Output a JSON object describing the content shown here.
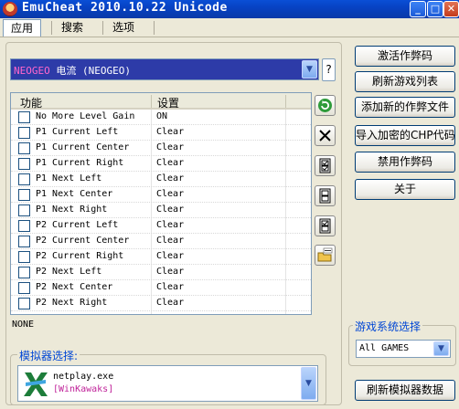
{
  "window": {
    "title": "EmuCheat 2010.10.22 Unicode"
  },
  "menu": {
    "apply": "应用",
    "search": "搜索",
    "options": "选项"
  },
  "game_select": {
    "tag": "NEOGEO",
    "name": " 电流 (NEOGEO)"
  },
  "help_label": "?",
  "table": {
    "headers": {
      "name": "功能",
      "setting": "设置"
    },
    "rows": [
      {
        "name": "No More Level Gain",
        "value": "ON"
      },
      {
        "name": "P1 Current Left",
        "value": "Clear"
      },
      {
        "name": "P1 Current Center",
        "value": "Clear"
      },
      {
        "name": "P1 Current Right",
        "value": "Clear"
      },
      {
        "name": "P1 Next Left",
        "value": "Clear"
      },
      {
        "name": "P1 Next Center",
        "value": "Clear"
      },
      {
        "name": "P1 Next Right",
        "value": "Clear"
      },
      {
        "name": "P2 Current Left",
        "value": "Clear"
      },
      {
        "name": "P2 Current Center",
        "value": "Clear"
      },
      {
        "name": "P2 Current Right",
        "value": "Clear"
      },
      {
        "name": "P2 Next Left",
        "value": "Clear"
      },
      {
        "name": "P2 Next Center",
        "value": "Clear"
      },
      {
        "name": "P2 Next Right",
        "value": "Clear"
      }
    ]
  },
  "status": "NONE",
  "emulator": {
    "legend": "模拟器选择:",
    "exe": "netplay.exe",
    "name": "[WinKawaks]"
  },
  "buttons": {
    "activate": "激活作弊码",
    "refresh_list": "刷新游戏列表",
    "add_file": "添加新的作弊文件",
    "import": "导入加密的CHP代码",
    "disable": "禁用作弊码",
    "about": "关于",
    "refresh_emu": "刷新模拟器数据"
  },
  "game_system": {
    "legend": "游戏系统选择",
    "selected": "All GAMES"
  },
  "colors": {
    "title_bar": "#0a4fd6",
    "group_label": "#0046d5",
    "emu_name": "#c0249a",
    "game_combo_bg": "#2d3ba8"
  }
}
